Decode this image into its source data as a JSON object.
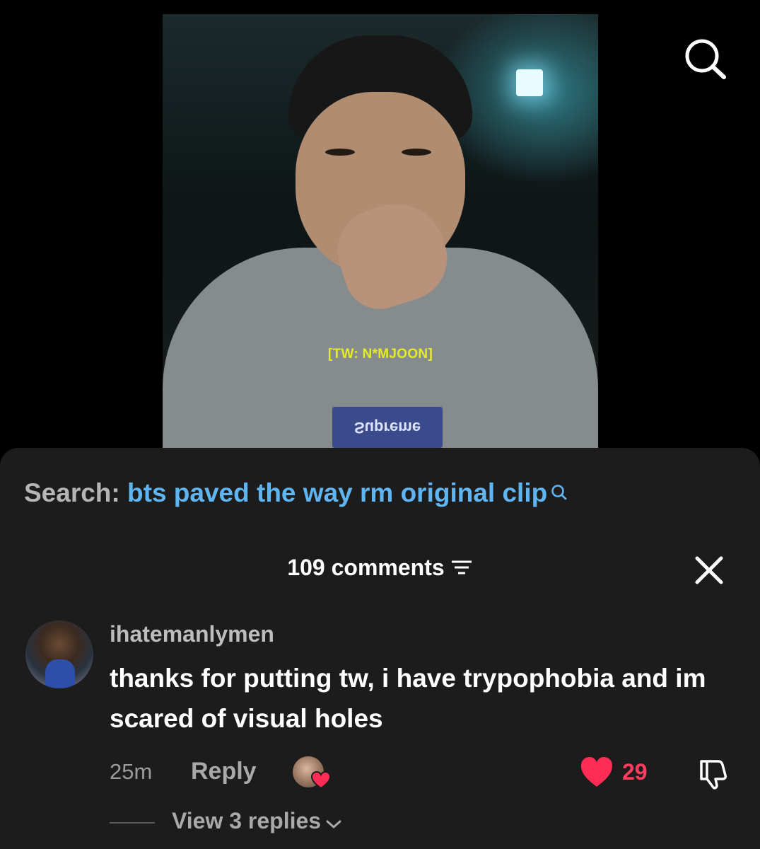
{
  "video": {
    "overlay_text": "[TW: N*MJOON]",
    "shirt_logo": "Supreme"
  },
  "search": {
    "label": "Search:",
    "query": "bts paved the way rm original clip"
  },
  "comments": {
    "header": "109 comments"
  },
  "comment": {
    "username": "ihatemanlymen",
    "text": "thanks for putting tw, i have trypophobia and im scared of visual holes",
    "time": "25m",
    "reply_label": "Reply",
    "like_count": "29",
    "view_replies": "View 3 replies"
  },
  "colors": {
    "sheet_bg": "#1c1c1c",
    "query_blue": "#5fb5f2",
    "like_red": "#ff3d5f",
    "overlay_yellow": "#e4ec2a"
  },
  "icons": [
    "search-icon",
    "filter-icon",
    "close-icon",
    "heart-icon",
    "dislike-icon",
    "chevron-down-icon"
  ]
}
